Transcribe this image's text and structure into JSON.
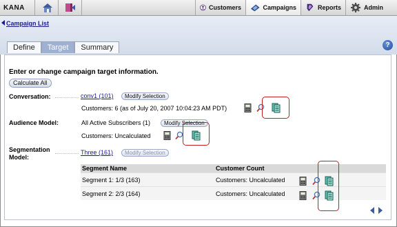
{
  "app": {
    "logo": "KANA"
  },
  "nav": {
    "tabs": [
      {
        "label": "Customers"
      },
      {
        "label": "Campaigns"
      },
      {
        "label": "Reports"
      },
      {
        "label": "Admin"
      }
    ]
  },
  "breadcrumb": {
    "label": "Campaign List"
  },
  "page_tabs": [
    {
      "label": "Define"
    },
    {
      "label": "Target"
    },
    {
      "label": "Summary"
    }
  ],
  "help": {
    "label": "?"
  },
  "main": {
    "instruction": "Enter or change campaign target information.",
    "calculate_all": "Calculate All",
    "conversation": {
      "label": "Conversation:",
      "link": "conv1 (101)",
      "modify": "Modify Selection",
      "customers": "Customers: 6 (as of July 20, 2007 10:04:23 AM PDT)"
    },
    "audience": {
      "label": "Audience Model:",
      "value": "All Active Subscribers (1)",
      "modify": "Modify Selection",
      "customers": "Customers: Uncalculated"
    },
    "segmentation": {
      "label_line1": "Segmentation",
      "label_line2": "Model:",
      "link": "Three (161)",
      "modify": "Modify Selection"
    },
    "table": {
      "headers": [
        "Segment Name",
        "Customer Count"
      ],
      "rows": [
        {
          "name": "Segment 1: 1/3 (163)",
          "count": "Customers: Uncalculated"
        },
        {
          "name": "Segment 2: 2/3 (164)",
          "count": "Customers: Uncalculated"
        }
      ]
    }
  },
  "colors": {
    "accent_blue": "#1a1a8c",
    "active_tab": "#9eb1d2",
    "callout_red": "#c21f1f"
  }
}
